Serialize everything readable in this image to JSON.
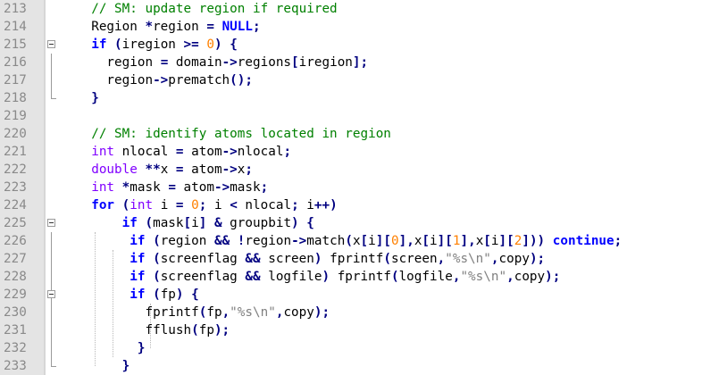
{
  "colors": {
    "gutter_bg": "#e4e4e4",
    "line_number": "#8a8a8a",
    "comment": "#008000",
    "keyword": "#0000ff",
    "type": "#8000ff",
    "operator": "#000080",
    "number": "#ff8000",
    "string": "#808080",
    "identifier": "#000000"
  },
  "editor": {
    "lines": [
      {
        "num": "213",
        "fold": "",
        "tokens": [
          {
            "t": "  ",
            "c": "id"
          },
          {
            "t": "// SM: update region if required",
            "c": "comment"
          }
        ]
      },
      {
        "num": "214",
        "fold": "",
        "tokens": [
          {
            "t": "  Region ",
            "c": "id"
          },
          {
            "t": "*",
            "c": "op"
          },
          {
            "t": "region ",
            "c": "id"
          },
          {
            "t": "=",
            "c": "op"
          },
          {
            "t": " ",
            "c": "id"
          },
          {
            "t": "NULL",
            "c": "kw"
          },
          {
            "t": ";",
            "c": "op"
          }
        ]
      },
      {
        "num": "215",
        "fold": "collapse",
        "tokens": [
          {
            "t": "  ",
            "c": "id"
          },
          {
            "t": "if",
            "c": "kw"
          },
          {
            "t": " ",
            "c": "id"
          },
          {
            "t": "(",
            "c": "op"
          },
          {
            "t": "iregion ",
            "c": "id"
          },
          {
            "t": ">=",
            "c": "op"
          },
          {
            "t": " ",
            "c": "id"
          },
          {
            "t": "0",
            "c": "num"
          },
          {
            "t": ")",
            "c": "op"
          },
          {
            "t": " ",
            "c": "id"
          },
          {
            "t": "{",
            "c": "op"
          }
        ]
      },
      {
        "num": "216",
        "fold": "",
        "tokens": [
          {
            "t": "    region ",
            "c": "id"
          },
          {
            "t": "=",
            "c": "op"
          },
          {
            "t": " domain",
            "c": "id"
          },
          {
            "t": "->",
            "c": "op"
          },
          {
            "t": "regions",
            "c": "id"
          },
          {
            "t": "[",
            "c": "op"
          },
          {
            "t": "iregion",
            "c": "id"
          },
          {
            "t": "];",
            "c": "op"
          }
        ]
      },
      {
        "num": "217",
        "fold": "",
        "tokens": [
          {
            "t": "    region",
            "c": "id"
          },
          {
            "t": "->",
            "c": "op"
          },
          {
            "t": "prematch",
            "c": "id"
          },
          {
            "t": "();",
            "c": "op"
          }
        ]
      },
      {
        "num": "218",
        "fold": "",
        "tokens": [
          {
            "t": "  ",
            "c": "id"
          },
          {
            "t": "}",
            "c": "op"
          }
        ]
      },
      {
        "num": "219",
        "fold": "",
        "tokens": []
      },
      {
        "num": "220",
        "fold": "",
        "tokens": [
          {
            "t": "  ",
            "c": "id"
          },
          {
            "t": "// SM: identify atoms located in region",
            "c": "comment"
          }
        ]
      },
      {
        "num": "221",
        "fold": "",
        "tokens": [
          {
            "t": "  ",
            "c": "id"
          },
          {
            "t": "int",
            "c": "type"
          },
          {
            "t": " nlocal ",
            "c": "id"
          },
          {
            "t": "=",
            "c": "op"
          },
          {
            "t": " atom",
            "c": "id"
          },
          {
            "t": "->",
            "c": "op"
          },
          {
            "t": "nlocal",
            "c": "id"
          },
          {
            "t": ";",
            "c": "op"
          }
        ]
      },
      {
        "num": "222",
        "fold": "",
        "tokens": [
          {
            "t": "  ",
            "c": "id"
          },
          {
            "t": "double",
            "c": "type"
          },
          {
            "t": " ",
            "c": "id"
          },
          {
            "t": "**",
            "c": "op"
          },
          {
            "t": "x ",
            "c": "id"
          },
          {
            "t": "=",
            "c": "op"
          },
          {
            "t": " atom",
            "c": "id"
          },
          {
            "t": "->",
            "c": "op"
          },
          {
            "t": "x",
            "c": "id"
          },
          {
            "t": ";",
            "c": "op"
          }
        ]
      },
      {
        "num": "223",
        "fold": "",
        "tokens": [
          {
            "t": "  ",
            "c": "id"
          },
          {
            "t": "int",
            "c": "type"
          },
          {
            "t": " ",
            "c": "id"
          },
          {
            "t": "*",
            "c": "op"
          },
          {
            "t": "mask ",
            "c": "id"
          },
          {
            "t": "=",
            "c": "op"
          },
          {
            "t": " atom",
            "c": "id"
          },
          {
            "t": "->",
            "c": "op"
          },
          {
            "t": "mask",
            "c": "id"
          },
          {
            "t": ";",
            "c": "op"
          }
        ]
      },
      {
        "num": "224",
        "fold": "",
        "tokens": [
          {
            "t": "  ",
            "c": "id"
          },
          {
            "t": "for",
            "c": "kw"
          },
          {
            "t": " ",
            "c": "id"
          },
          {
            "t": "(",
            "c": "op"
          },
          {
            "t": "int",
            "c": "type"
          },
          {
            "t": " i ",
            "c": "id"
          },
          {
            "t": "=",
            "c": "op"
          },
          {
            "t": " ",
            "c": "id"
          },
          {
            "t": "0",
            "c": "num"
          },
          {
            "t": ";",
            "c": "op"
          },
          {
            "t": " i ",
            "c": "id"
          },
          {
            "t": "<",
            "c": "op"
          },
          {
            "t": " nlocal",
            "c": "id"
          },
          {
            "t": ";",
            "c": "op"
          },
          {
            "t": " i",
            "c": "id"
          },
          {
            "t": "++)",
            "c": "op"
          }
        ]
      },
      {
        "num": "225",
        "fold": "collapse",
        "tokens": [
          {
            "t": "      ",
            "c": "id"
          },
          {
            "t": "if",
            "c": "kw"
          },
          {
            "t": " ",
            "c": "id"
          },
          {
            "t": "(",
            "c": "op"
          },
          {
            "t": "mask",
            "c": "id"
          },
          {
            "t": "[",
            "c": "op"
          },
          {
            "t": "i",
            "c": "id"
          },
          {
            "t": "]",
            "c": "op"
          },
          {
            "t": " ",
            "c": "id"
          },
          {
            "t": "&",
            "c": "op"
          },
          {
            "t": " groupbit",
            "c": "id"
          },
          {
            "t": ")",
            "c": "op"
          },
          {
            "t": " ",
            "c": "id"
          },
          {
            "t": "{",
            "c": "op"
          }
        ]
      },
      {
        "num": "226",
        "fold": "",
        "tokens": [
          {
            "t": "       ",
            "c": "id"
          },
          {
            "t": "if",
            "c": "kw"
          },
          {
            "t": " ",
            "c": "id"
          },
          {
            "t": "(",
            "c": "op"
          },
          {
            "t": "region ",
            "c": "id"
          },
          {
            "t": "&&",
            "c": "op"
          },
          {
            "t": " ",
            "c": "id"
          },
          {
            "t": "!",
            "c": "op"
          },
          {
            "t": "region",
            "c": "id"
          },
          {
            "t": "->",
            "c": "op"
          },
          {
            "t": "match",
            "c": "id"
          },
          {
            "t": "(",
            "c": "op"
          },
          {
            "t": "x",
            "c": "id"
          },
          {
            "t": "[",
            "c": "op"
          },
          {
            "t": "i",
            "c": "id"
          },
          {
            "t": "][",
            "c": "op"
          },
          {
            "t": "0",
            "c": "num"
          },
          {
            "t": "],",
            "c": "op"
          },
          {
            "t": "x",
            "c": "id"
          },
          {
            "t": "[",
            "c": "op"
          },
          {
            "t": "i",
            "c": "id"
          },
          {
            "t": "][",
            "c": "op"
          },
          {
            "t": "1",
            "c": "num"
          },
          {
            "t": "],",
            "c": "op"
          },
          {
            "t": "x",
            "c": "id"
          },
          {
            "t": "[",
            "c": "op"
          },
          {
            "t": "i",
            "c": "id"
          },
          {
            "t": "][",
            "c": "op"
          },
          {
            "t": "2",
            "c": "num"
          },
          {
            "t": "]))",
            "c": "op"
          },
          {
            "t": " ",
            "c": "id"
          },
          {
            "t": "continue",
            "c": "kw"
          },
          {
            "t": ";",
            "c": "op"
          }
        ]
      },
      {
        "num": "227",
        "fold": "",
        "tokens": [
          {
            "t": "       ",
            "c": "id"
          },
          {
            "t": "if",
            "c": "kw"
          },
          {
            "t": " ",
            "c": "id"
          },
          {
            "t": "(",
            "c": "op"
          },
          {
            "t": "screenflag ",
            "c": "id"
          },
          {
            "t": "&&",
            "c": "op"
          },
          {
            "t": " screen",
            "c": "id"
          },
          {
            "t": ")",
            "c": "op"
          },
          {
            "t": " fprintf",
            "c": "id"
          },
          {
            "t": "(",
            "c": "op"
          },
          {
            "t": "screen",
            "c": "id"
          },
          {
            "t": ",",
            "c": "op"
          },
          {
            "t": "\"%s\\n\"",
            "c": "str"
          },
          {
            "t": ",",
            "c": "op"
          },
          {
            "t": "copy",
            "c": "id"
          },
          {
            "t": ");",
            "c": "op"
          }
        ]
      },
      {
        "num": "228",
        "fold": "",
        "tokens": [
          {
            "t": "       ",
            "c": "id"
          },
          {
            "t": "if",
            "c": "kw"
          },
          {
            "t": " ",
            "c": "id"
          },
          {
            "t": "(",
            "c": "op"
          },
          {
            "t": "screenflag ",
            "c": "id"
          },
          {
            "t": "&&",
            "c": "op"
          },
          {
            "t": " logfile",
            "c": "id"
          },
          {
            "t": ")",
            "c": "op"
          },
          {
            "t": " fprintf",
            "c": "id"
          },
          {
            "t": "(",
            "c": "op"
          },
          {
            "t": "logfile",
            "c": "id"
          },
          {
            "t": ",",
            "c": "op"
          },
          {
            "t": "\"%s\\n\"",
            "c": "str"
          },
          {
            "t": ",",
            "c": "op"
          },
          {
            "t": "copy",
            "c": "id"
          },
          {
            "t": ");",
            "c": "op"
          }
        ]
      },
      {
        "num": "229",
        "fold": "collapse",
        "tokens": [
          {
            "t": "       ",
            "c": "id"
          },
          {
            "t": "if",
            "c": "kw"
          },
          {
            "t": " ",
            "c": "id"
          },
          {
            "t": "(",
            "c": "op"
          },
          {
            "t": "fp",
            "c": "id"
          },
          {
            "t": ")",
            "c": "op"
          },
          {
            "t": " ",
            "c": "id"
          },
          {
            "t": "{",
            "c": "op"
          }
        ]
      },
      {
        "num": "230",
        "fold": "",
        "tokens": [
          {
            "t": "         fprintf",
            "c": "id"
          },
          {
            "t": "(",
            "c": "op"
          },
          {
            "t": "fp",
            "c": "id"
          },
          {
            "t": ",",
            "c": "op"
          },
          {
            "t": "\"%s\\n\"",
            "c": "str"
          },
          {
            "t": ",",
            "c": "op"
          },
          {
            "t": "copy",
            "c": "id"
          },
          {
            "t": ");",
            "c": "op"
          }
        ]
      },
      {
        "num": "231",
        "fold": "",
        "tokens": [
          {
            "t": "         fflush",
            "c": "id"
          },
          {
            "t": "(",
            "c": "op"
          },
          {
            "t": "fp",
            "c": "id"
          },
          {
            "t": ");",
            "c": "op"
          }
        ]
      },
      {
        "num": "232",
        "fold": "",
        "tokens": [
          {
            "t": "        ",
            "c": "id"
          },
          {
            "t": "}",
            "c": "op"
          }
        ]
      },
      {
        "num": "233",
        "fold": "",
        "tokens": [
          {
            "t": "      ",
            "c": "id"
          },
          {
            "t": "}",
            "c": "op"
          }
        ]
      }
    ]
  }
}
